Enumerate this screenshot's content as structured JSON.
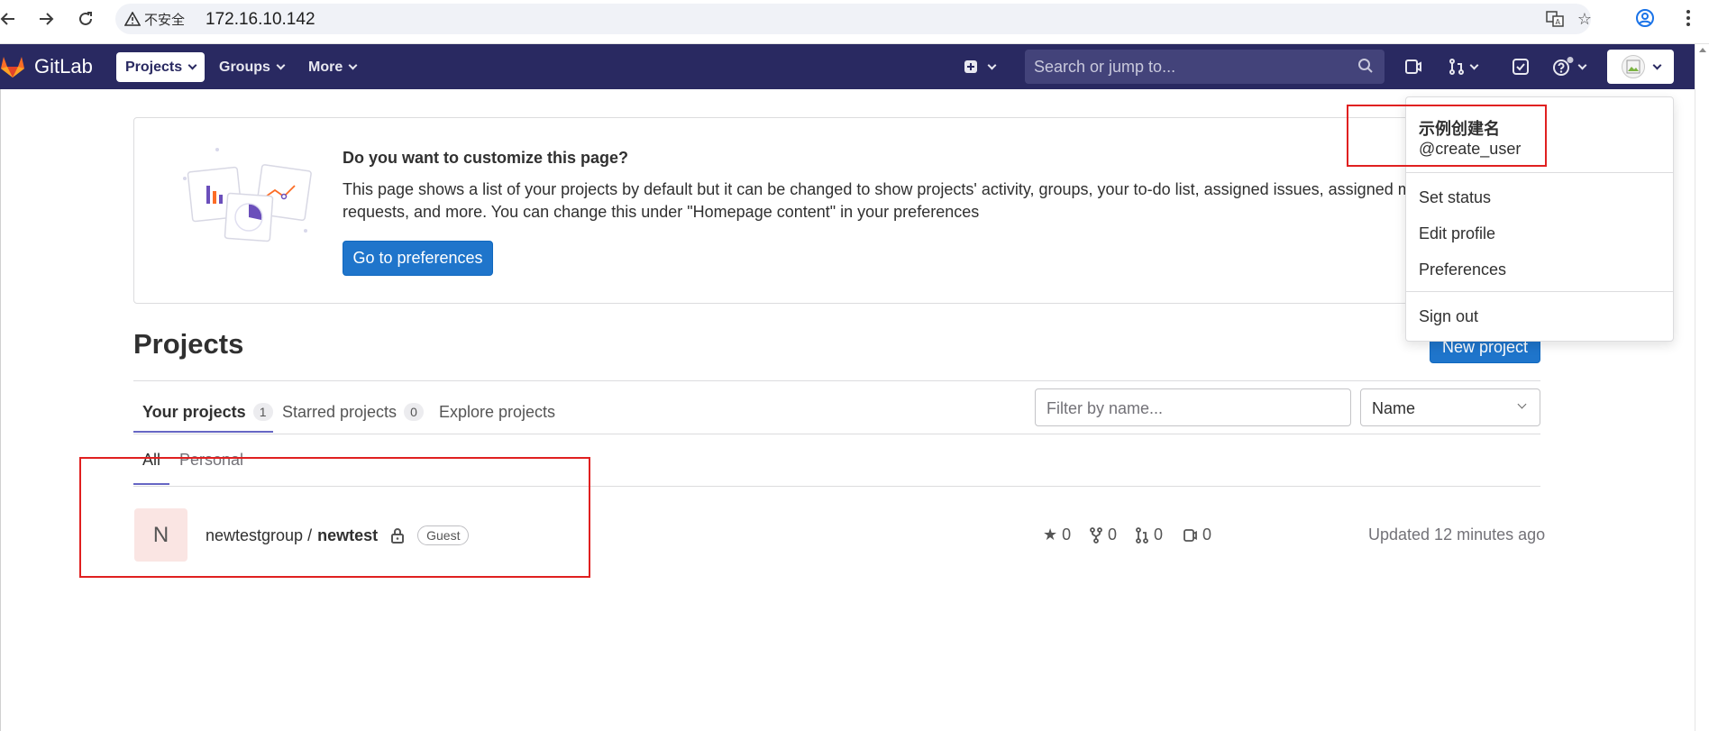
{
  "browser": {
    "security_label": "不安全",
    "url": "172.16.10.142"
  },
  "nav": {
    "brand": "GitLab",
    "projects_label": "Projects",
    "groups_label": "Groups",
    "more_label": "More",
    "search_placeholder": "Search or jump to...",
    "notification_color": "#c8c8d8"
  },
  "customize": {
    "title": "Do you want to customize this page?",
    "text": "This page shows a list of your projects by default but it can be changed to show projects' activity, groups, your to-do list, assigned issues, assigned merge requests, and more. You can change this under \"Homepage content\" in your preferences",
    "button_label": "Go to preferences"
  },
  "projects": {
    "title": "Projects",
    "new_project_label": "New project",
    "tabs": [
      {
        "label": "Your projects",
        "count": "1"
      },
      {
        "label": "Starred projects",
        "count": "0"
      },
      {
        "label": "Explore projects"
      }
    ],
    "filter_placeholder": "Filter by name...",
    "sort_value": "Name",
    "subtabs": [
      "All",
      "Personal"
    ],
    "items": [
      {
        "avatar_letter": "N",
        "namespace": "newtestgroup / ",
        "name": "newtest",
        "role": "Guest",
        "stars": "0",
        "forks": "0",
        "merge_requests": "0",
        "issues": "0",
        "updated": "Updated 12 minutes ago"
      }
    ]
  },
  "user_menu": {
    "display_name": "示例创建名",
    "username": "@create_user",
    "items": [
      "Set status",
      "Edit profile",
      "Preferences"
    ],
    "sign_out": "Sign out"
  },
  "colors": {
    "navbar": "#292961",
    "primary_button": "#1f75cb",
    "annotation_red": "#e02020",
    "tab_underline": "#6666c4"
  }
}
